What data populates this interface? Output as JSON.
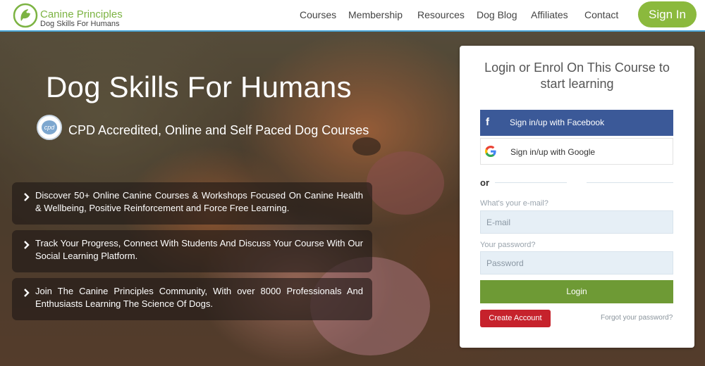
{
  "header": {
    "logo": {
      "name": "Canine Principles",
      "tagline": "Dog Skills For Humans",
      "icon": "dog-logo-icon"
    },
    "nav": [
      {
        "label": "Courses"
      },
      {
        "label": "Membership"
      },
      {
        "label": "Resources"
      },
      {
        "label": "Dog Blog"
      },
      {
        "label": "Affiliates"
      },
      {
        "label": "Contact"
      }
    ],
    "signin_label": "Sign In"
  },
  "hero": {
    "title": "Dog Skills For Humans",
    "cpd_badge_text": "cpd",
    "cpd_text": "CPD Accredited, Online  and Self Paced Dog Courses",
    "features": [
      {
        "text": "Discover 50+ Online Canine Courses & Workshops Focused On Canine Health & Wellbeing, Positive Reinforcement  and Force Free Learning."
      },
      {
        "text": "Track Your Progress, Connect With Students And Discuss Your Course With Our Social Learning Platform."
      },
      {
        "text": "Join The Canine Principles Community, With over 8000 Professionals And Enthusiasts Learning The Science Of Dogs."
      }
    ]
  },
  "login": {
    "title": "Login or Enrol On This Course to start learning",
    "facebook_label": "Sign in/up with Facebook",
    "google_label": "Sign in/up with Google",
    "or_label": "or",
    "email_label": "What's your e-mail?",
    "email_placeholder": "E-mail",
    "password_label": "Your password?",
    "password_placeholder": "Password",
    "login_label": "Login",
    "create_label": "Create Account",
    "forgot_label": "Forgot your password?"
  },
  "colors": {
    "brand_green": "#8bb93d",
    "login_green": "#6e9a35",
    "facebook_blue": "#3b5998",
    "create_red": "#c6222c",
    "header_accent": "#4aa8d8"
  }
}
